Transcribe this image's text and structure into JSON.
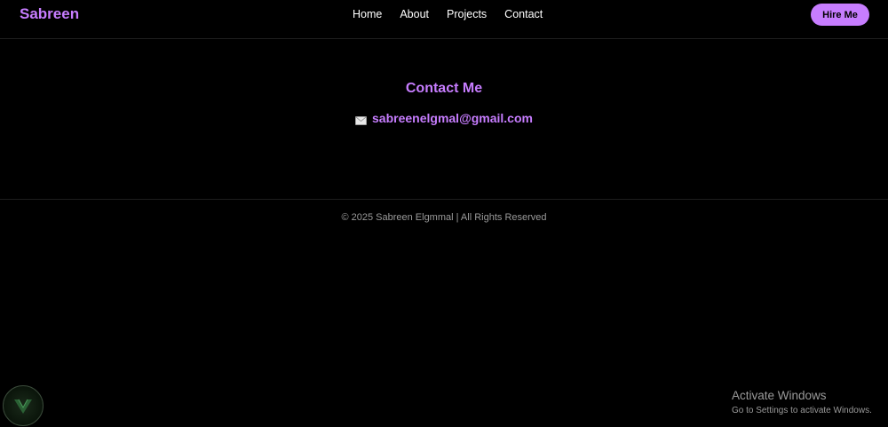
{
  "navbar": {
    "brand": "Sabreen",
    "links": [
      "Home",
      "About",
      "Projects",
      "Contact"
    ],
    "hire_label": "Hire Me"
  },
  "contact": {
    "title": "Contact Me",
    "email_icon": "envelope-icon",
    "email": "sabreenelgmal@gmail.com"
  },
  "footer": {
    "copyright": "© 2025 Sabreen Elgmmal | All Rights Reserved"
  },
  "watermark": {
    "title": "Activate Windows",
    "subtitle": "Go to Settings to activate Windows."
  },
  "colors": {
    "accent": "#c77dff",
    "background": "#000000",
    "muted_text": "#9a9a9a"
  }
}
